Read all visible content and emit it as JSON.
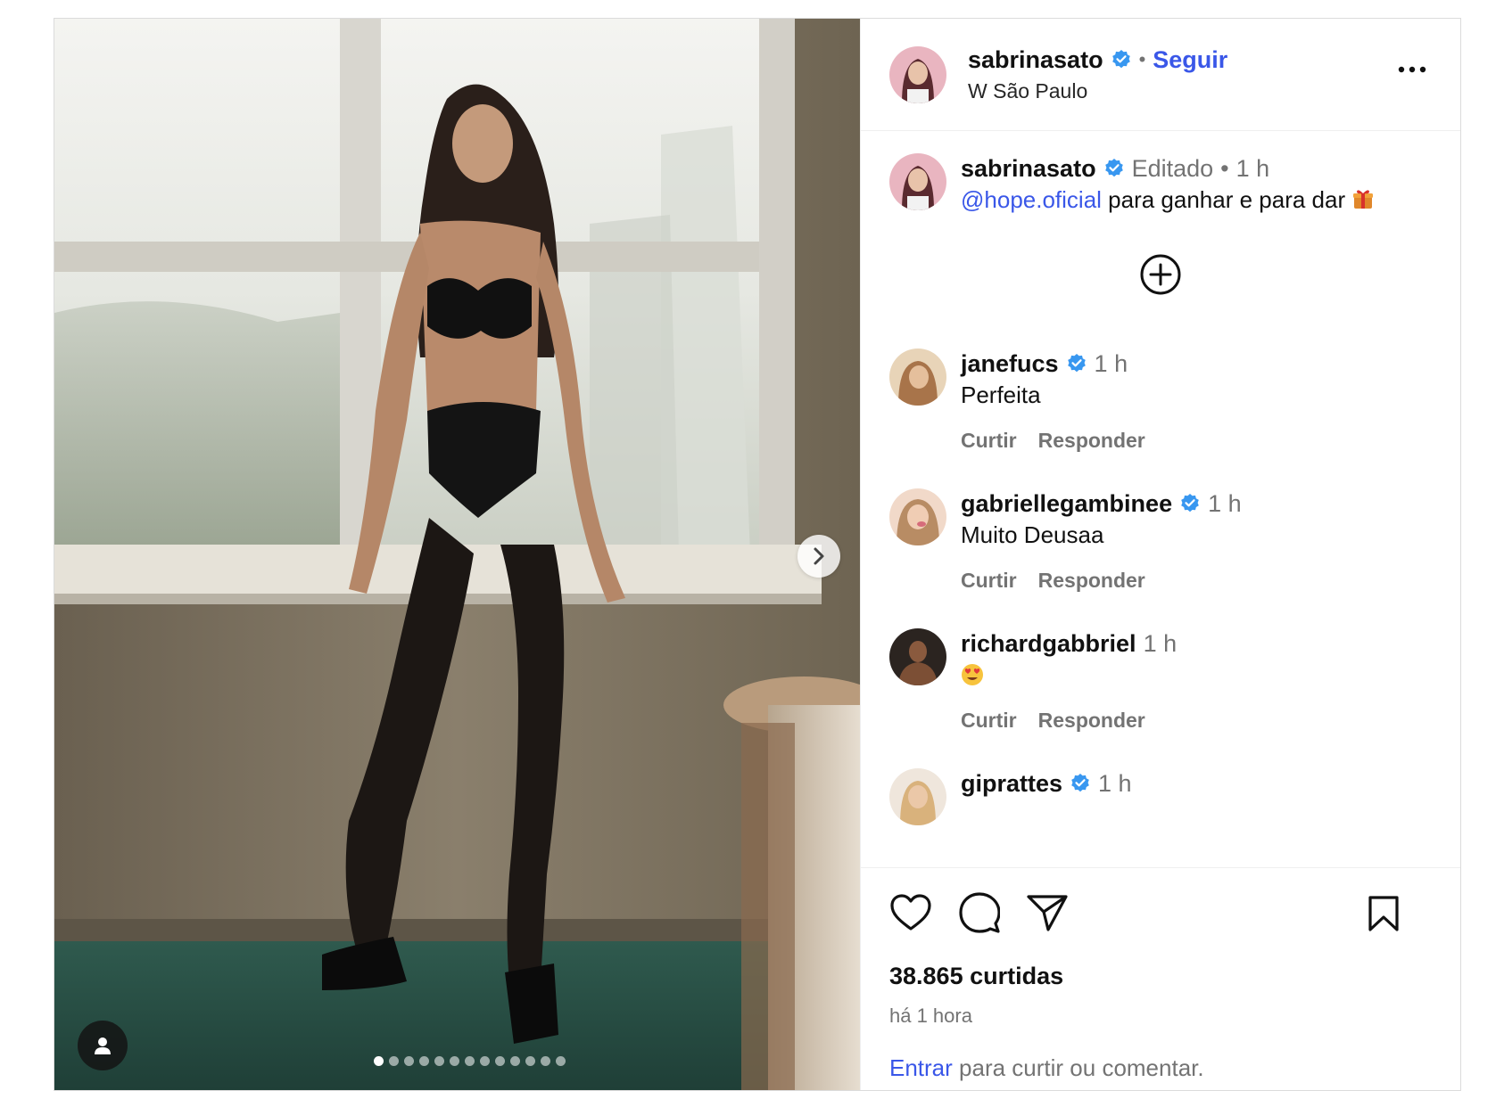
{
  "post": {
    "author": "sabrinasato",
    "follow_separator": "•",
    "follow_label": "Seguir",
    "location": "W São Paulo",
    "more_label": "•••"
  },
  "caption": {
    "author": "sabrinasato",
    "edited_label": "Editado",
    "dot": "•",
    "time": "1 h",
    "mention": "@hope.oficial",
    "text": " para ganhar e para dar",
    "emoji": "gift"
  },
  "comments": [
    {
      "user": "janefucs",
      "verified": true,
      "time": "1 h",
      "text": "Perfeita",
      "like": "Curtir",
      "reply": "Responder"
    },
    {
      "user": "gabriellegambinee",
      "verified": true,
      "time": "1 h",
      "text": "Muito Deusaa",
      "like": "Curtir",
      "reply": "Responder"
    },
    {
      "user": "richardgabbriel",
      "verified": false,
      "time": "1 h",
      "text": "",
      "emoji": "heart-eyes",
      "like": "Curtir",
      "reply": "Responder"
    },
    {
      "user": "giprattes",
      "verified": true,
      "time": "1 h"
    }
  ],
  "stats": {
    "likes": "38.865 curtidas",
    "posted": "há 1 hora"
  },
  "login": {
    "link": "Entrar",
    "text": " para curtir ou comentar."
  },
  "carousel": {
    "total": 13,
    "current": 1
  },
  "colors": {
    "link_blue": "#3a57e8",
    "verified_blue": "#3897f0",
    "muted": "#737373"
  }
}
